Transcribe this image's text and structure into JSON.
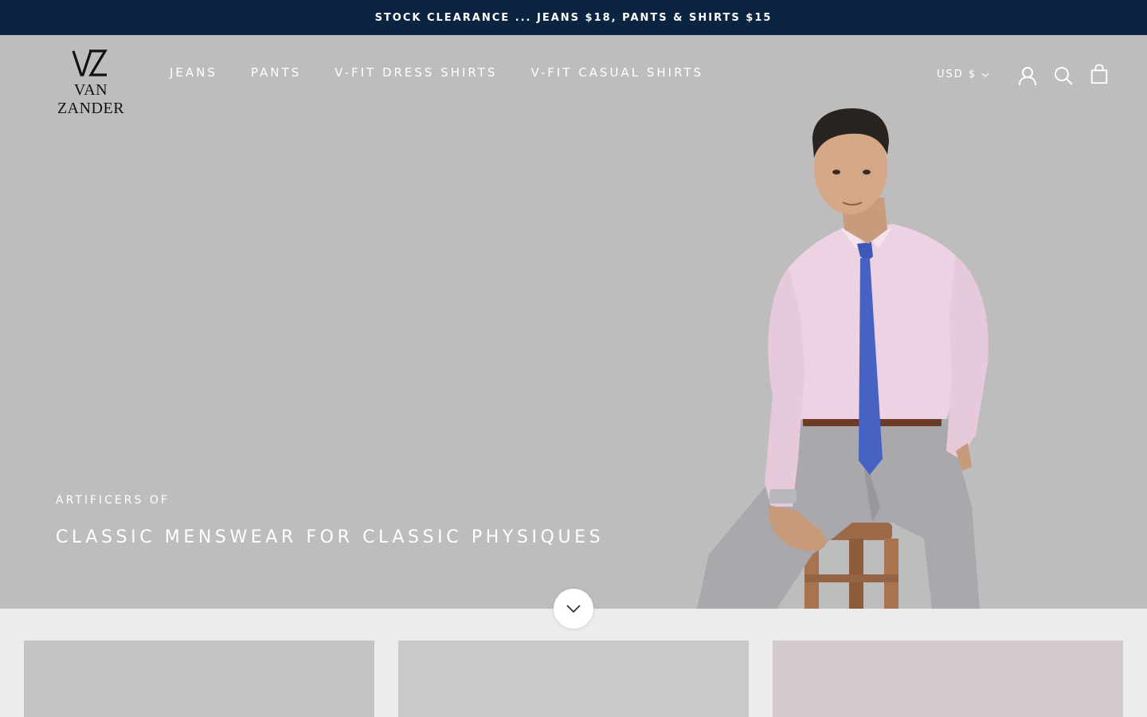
{
  "announcement": {
    "text": "STOCK CLEARANCE ... JEANS $18, PANTS & SHIRTS $15",
    "background": "#0b2440"
  },
  "header": {
    "logo": {
      "monogram": "VZ",
      "wordmark": "VAN ZANDER"
    },
    "nav": [
      {
        "label": "JEANS"
      },
      {
        "label": "PANTS"
      },
      {
        "label": "V-FIT DRESS SHIRTS"
      },
      {
        "label": "V-FIT CASUAL SHIRTS"
      }
    ],
    "currency": {
      "label": "USD $",
      "icon": "chevron-down-icon"
    },
    "icons": [
      "account-icon",
      "search-icon",
      "cart-bag-icon"
    ]
  },
  "hero": {
    "background": "#bdbdbd",
    "subtitle": "ARTIFICERS OF",
    "title": "CLASSIC MENSWEAR FOR CLASSIC PHYSIQUES",
    "image": "model-photo",
    "scroll_icon": "chevron-down-icon"
  },
  "collections": [
    {
      "color": "#c4c4c3"
    },
    {
      "color": "#c9c9cc"
    },
    {
      "color": "#d3cbcb"
    }
  ]
}
